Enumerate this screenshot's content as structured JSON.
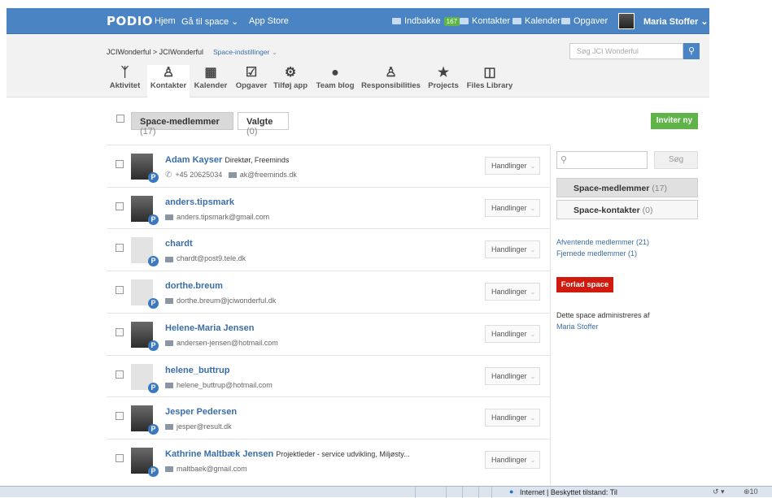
{
  "topbar": {
    "logo": "PODIO",
    "home": "Hjem",
    "goto_space": "Gå til space",
    "app_store": "App Store",
    "inbox": "Indbakke",
    "inbox_count": "167",
    "contacts": "Kontakter",
    "calendar": "Kalender",
    "tasks": "Opgaver",
    "user": "Maria Stoffer"
  },
  "breadcrumb": {
    "org": "JCIWonderful",
    "sep": ">",
    "space": "JCIWonderful",
    "settings": "Space-indstillinger"
  },
  "search": {
    "placeholder": "Søg JCI Wonderful"
  },
  "tabs": [
    {
      "label": "Aktivitet",
      "icon": "activity-icon"
    },
    {
      "label": "Kontakter",
      "icon": "contacts-icon"
    },
    {
      "label": "Kalender",
      "icon": "calendar-icon"
    },
    {
      "label": "Opgaver",
      "icon": "tasks-icon"
    },
    {
      "label": "Tilføj app",
      "icon": "add-app-icon"
    },
    {
      "label": "Team blog",
      "icon": "blog-icon"
    },
    {
      "label": "Responsibilities",
      "icon": "person-icon"
    },
    {
      "label": "Projects",
      "icon": "star-icon"
    },
    {
      "label": "Files Library",
      "icon": "files-icon"
    }
  ],
  "filter": {
    "members_label": "Space-medlemmer",
    "members_count": "(17)",
    "selected_label": "Valgte",
    "selected_count": "(0)",
    "invite": "Inviter ny"
  },
  "members": [
    {
      "name": "Adam Kayser",
      "role": "Direktør, Freeminds",
      "phone": "+45 20625034",
      "email": "ak@freeminds.dk",
      "actions": "Handlinger",
      "photo": true
    },
    {
      "name": "anders.tipsmark",
      "role": "",
      "phone": "",
      "email": "anders.tipsmark@gmail.com",
      "actions": "Handlinger",
      "photo": true
    },
    {
      "name": "chardt",
      "role": "",
      "phone": "",
      "email": "chardt@post9.tele.dk",
      "actions": "Handlinger",
      "photo": false
    },
    {
      "name": "dorthe.breum",
      "role": "",
      "phone": "",
      "email": "dorthe.breum@jciwonderful.dk",
      "actions": "Handlinger",
      "photo": false
    },
    {
      "name": "Helene-Maria Jensen",
      "role": "",
      "phone": "",
      "email": "andersen-jensen@hotmail.com",
      "actions": "Handlinger",
      "photo": true
    },
    {
      "name": "helene_buttrup",
      "role": "",
      "phone": "",
      "email": "helene_buttrup@hotmail.com",
      "actions": "Handlinger",
      "photo": false
    },
    {
      "name": "Jesper Pedersen",
      "role": "",
      "phone": "",
      "email": "jesper@result.dk",
      "actions": "Handlinger",
      "photo": true
    },
    {
      "name": "Kathrine Maltbæk Jensen",
      "role": "Projektleder - service udvikling, Miljøsty...",
      "phone": "",
      "email": "maltbaek@gmail.com",
      "actions": "Handlinger",
      "photo": true
    }
  ],
  "sidebar": {
    "search_button": "Søg",
    "members_label": "Space-medlemmer",
    "members_count": "(17)",
    "contacts_label": "Space-kontakter",
    "contacts_count": "(0)",
    "pending": "Afventende medlemmer (21)",
    "removed": "Fjernede medlemmer (1)",
    "leave": "Forlad space",
    "admin_text": "Dette space administreres af",
    "admin_name": "Maria Stoffer"
  },
  "statusbar": {
    "zone": "Internet | Beskyttet tilstand: Til",
    "zoom": "10"
  }
}
